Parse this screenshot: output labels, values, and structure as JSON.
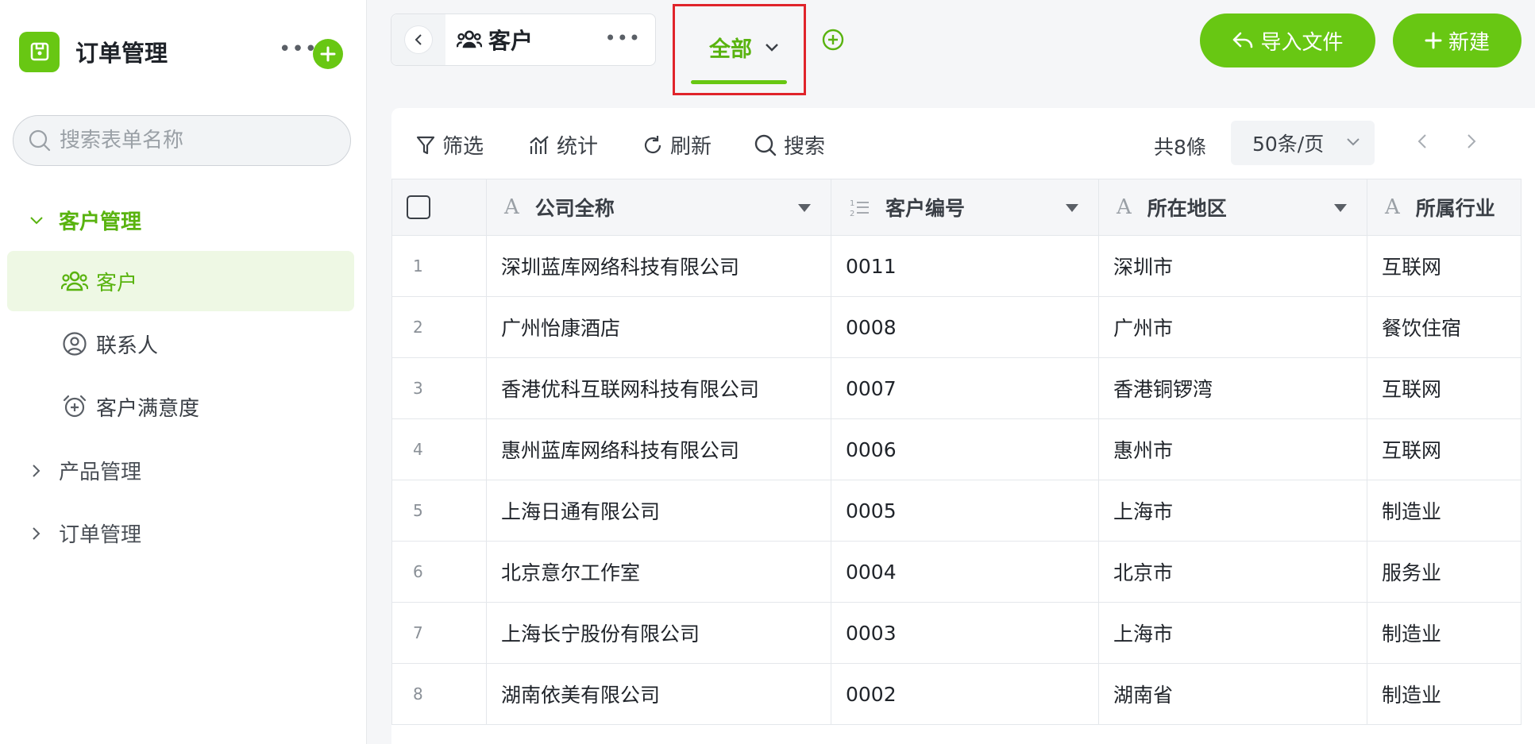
{
  "app": {
    "title": "订单管理",
    "more_label": "•••"
  },
  "sidebar": {
    "search_placeholder": "搜索表单名称",
    "groups": [
      {
        "label": "客户管理",
        "expanded": true
      },
      {
        "label": "产品管理",
        "expanded": false
      },
      {
        "label": "订单管理",
        "expanded": false
      }
    ],
    "items": [
      {
        "label": "客户",
        "icon": "users-icon",
        "selected": true
      },
      {
        "label": "联系人",
        "icon": "user-circle-icon",
        "selected": false
      },
      {
        "label": "客户满意度",
        "icon": "alarm-plus-icon",
        "selected": false
      }
    ]
  },
  "header": {
    "form_title": "客户",
    "form_more": "•••",
    "view_tab": "全部",
    "import_label": "导入文件",
    "new_label": "新建"
  },
  "toolbar": {
    "filter": "筛选",
    "stats": "统计",
    "refresh": "刷新",
    "search": "搜索",
    "count": "共8條",
    "page_size": "50条/页"
  },
  "table": {
    "columns": [
      "公司全称",
      "客户编号",
      "所在地区",
      "所属行业"
    ],
    "rows": [
      {
        "idx": "1",
        "company": "深圳蓝库网络科技有限公司",
        "code": "0011",
        "region": "深圳市",
        "industry": "互联网"
      },
      {
        "idx": "2",
        "company": "广州怡康酒店",
        "code": "0008",
        "region": "广州市",
        "industry": "餐饮住宿"
      },
      {
        "idx": "3",
        "company": "香港优科互联网科技有限公司",
        "code": "0007",
        "region": "香港铜锣湾",
        "industry": "互联网"
      },
      {
        "idx": "4",
        "company": "惠州蓝库网络科技有限公司",
        "code": "0006",
        "region": "惠州市",
        "industry": "互联网"
      },
      {
        "idx": "5",
        "company": "上海日通有限公司",
        "code": "0005",
        "region": "上海市",
        "industry": "制造业"
      },
      {
        "idx": "6",
        "company": "北京意尔工作室",
        "code": "0004",
        "region": "北京市",
        "industry": "服务业"
      },
      {
        "idx": "7",
        "company": "上海长宁股份有限公司",
        "code": "0003",
        "region": "上海市",
        "industry": "制造业"
      },
      {
        "idx": "8",
        "company": "湖南依美有限公司",
        "code": "0002",
        "region": "湖南省",
        "industry": "制造业"
      }
    ]
  },
  "colors": {
    "accent": "#68c713",
    "accent_text": "#59b30f",
    "highlight_border": "#e0242b",
    "selected_bg": "#eef8e4"
  }
}
